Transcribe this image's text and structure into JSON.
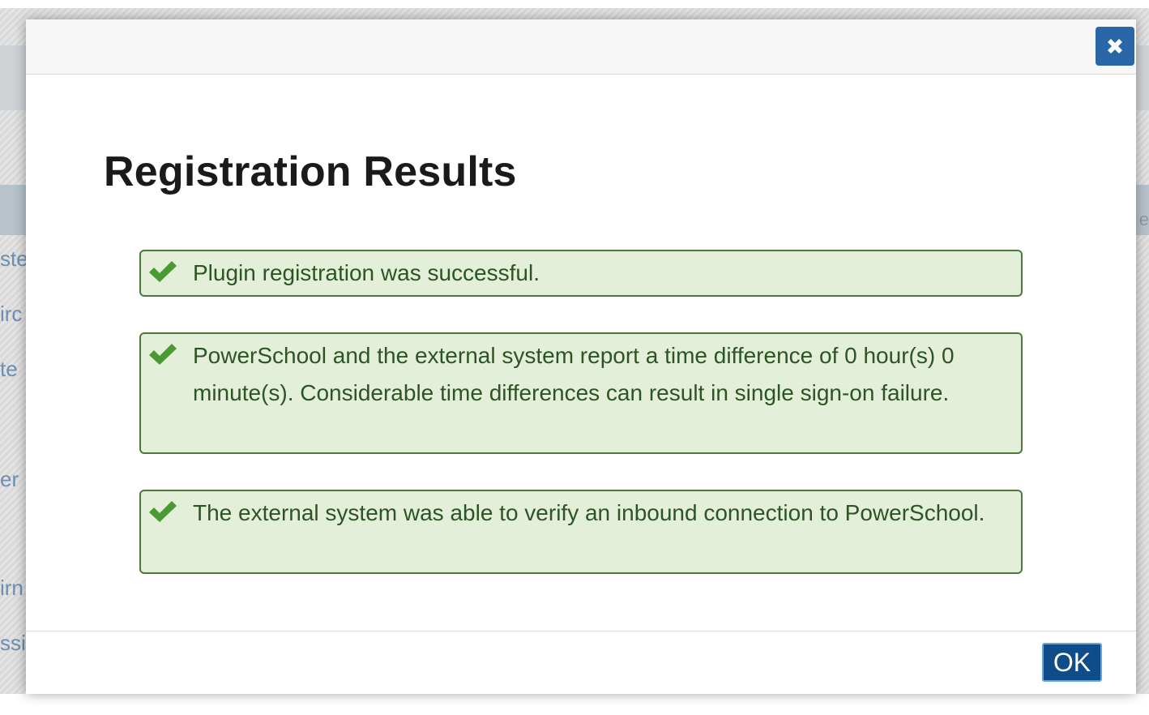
{
  "background": {
    "fragments": [
      "ste",
      "irc",
      "te",
      "er",
      "irn",
      "ssi"
    ],
    "right_fragment": "e"
  },
  "dialog": {
    "close_icon": "close-icon",
    "title": "Registration Results",
    "alerts": [
      {
        "icon": "checkmark-icon",
        "text": "Plugin registration was successful."
      },
      {
        "icon": "checkmark-icon",
        "text": "PowerSchool and the external system report a time difference of 0 hour(s) 0 minute(s). Considerable time differences can result in single sign-on failure."
      },
      {
        "icon": "checkmark-icon",
        "text": "The external system was able to verify an inbound connection to PowerSchool."
      }
    ],
    "ok_label": "OK"
  },
  "colors": {
    "alert_bg": "#e3efd9",
    "alert_border": "#4d7a39",
    "alert_text": "#2d5424",
    "check_green": "#4a9a33",
    "close_button": "#2a67a8",
    "ok_button": "#0f4c8a"
  }
}
